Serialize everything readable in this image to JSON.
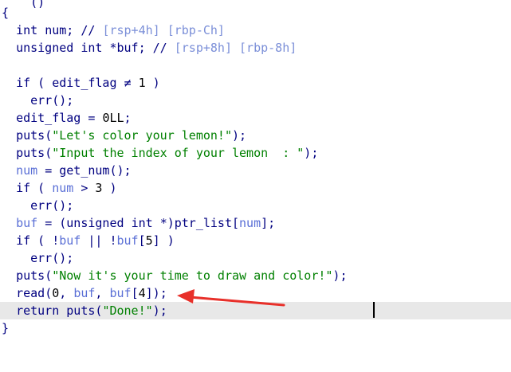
{
  "code_lines": [
    {
      "text": "    ()"
    },
    {
      "text": "{"
    },
    {
      "text": "  int num; // [rsp+4h] [rbp-Ch]"
    },
    {
      "text": "  unsigned int *buf; // [rsp+8h] [rbp-8h]"
    },
    {
      "text": ""
    },
    {
      "text": "  if ( edit_flag ≠ 1 )"
    },
    {
      "text": "    err();"
    },
    {
      "text": "  edit_flag = 0LL;"
    },
    {
      "text": "  puts(\"Let's color your lemon!\");"
    },
    {
      "text": "  puts(\"Input the index of your lemon  : \");"
    },
    {
      "text": "  num = get_num();"
    },
    {
      "text": "  if ( num > 3 )"
    },
    {
      "text": "    err();"
    },
    {
      "text": "  buf = (unsigned int *)ptr_list[num];"
    },
    {
      "text": "  if ( !buf || !buf[5] )"
    },
    {
      "text": "    err();"
    },
    {
      "text": "  puts(\"Now it's your time to draw and color!\");"
    },
    {
      "text": "  read(0, buf, buf[4]);"
    },
    {
      "text": "  return puts(\"Done!\");"
    },
    {
      "text": "}"
    }
  ],
  "highlighted_line_index": 18,
  "arrow_color": "#e8302a",
  "highlight_color": "#e8e8e8"
}
